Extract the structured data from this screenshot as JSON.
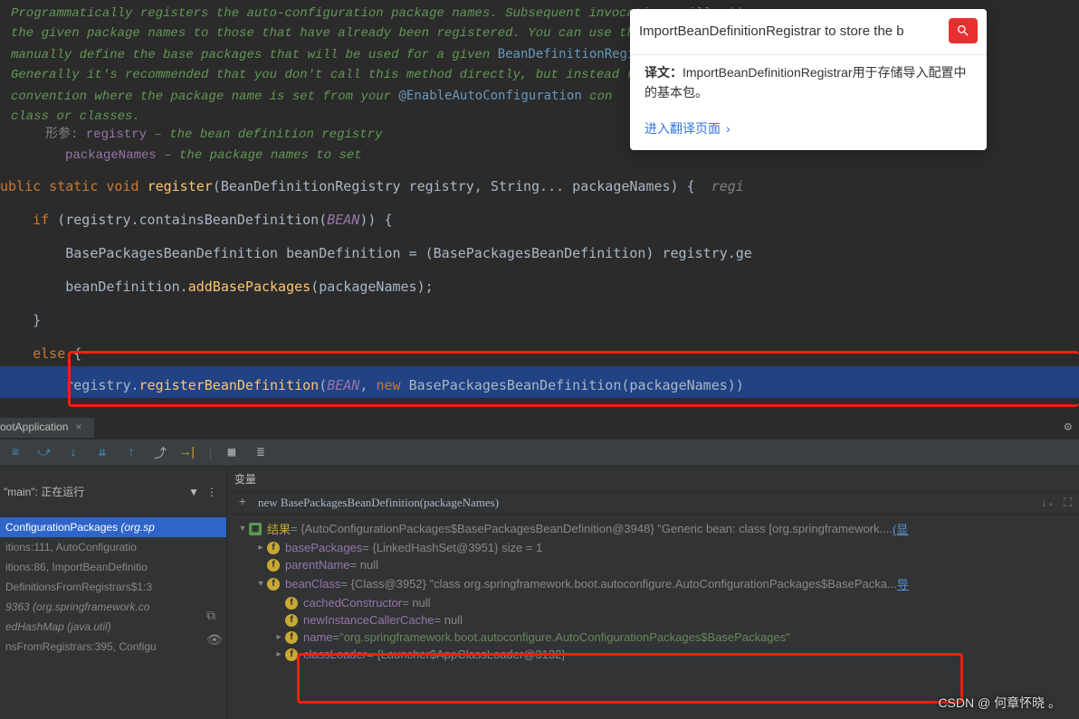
{
  "javadoc": {
    "line1a": "Programmatically registers the auto-configuration package names. Subsequent invocations will add",
    "line2a": "the given package names to those that have already been registered. You can use this method to",
    "line3a": "manually define the base packages that will be used for a given ",
    "line3b": "BeanDefinitionRegis",
    "line4a": "Generally it's recommended that you don't call this method directly, but instead rely on",
    "line5a": "convention where the package name is set from your ",
    "line5b": "@EnableAutoConfiguration",
    "line5c": " con",
    "line6a": "class or classes.",
    "params_label": "形参:",
    "param1_name": "registry",
    "param1_desc": " – the bean definition registry",
    "param2_name": "packageNames",
    "param2_desc": " – the package names to set"
  },
  "code": {
    "sig1": "ublic static void ",
    "sig2": "register",
    "sig3": "(BeanDefinitionRegistry registry, String... packageNames) {  ",
    "sig4": "regi",
    "if1": "    if ",
    "if2": "(registry.containsBeanDefinition(",
    "if3": "BEAN",
    "if4": ")) {",
    "b1": "        BasePackagesBeanDefinition beanDefinition = (BasePackagesBeanDefinition) registry.ge",
    "b2a": "        beanDefinition.",
    "b2b": "addBasePackages",
    "b2c": "(packageNames);",
    "b3": "    }",
    "else": "    else ",
    "else2": "{",
    "reg1": "        registry.",
    "reg2": "registerBeanDefinition",
    "reg3": "(",
    "reg4": "BEAN",
    "reg5": ", ",
    "reg6": "new ",
    "reg7": "BasePackagesBeanDefinition(packageNames))"
  },
  "translate": {
    "input_value": "ImportBeanDefinitionRegistrar to store the b",
    "label": "译文：",
    "text": "ImportBeanDefinitionRegistrar用于存储导入配置中的基本包。",
    "link": "进入翻译页面"
  },
  "run_tab": "ootApplication",
  "frames": {
    "header": "\"main\": 正在运行",
    "items": [
      "ConfigurationPackages",
      "(org.sp",
      "itions:111, AutoConfiguratio",
      "itions:86, ImportBeanDefinitio",
      "DefinitionsFromRegistrars$1:3",
      "9363 (org.springframework.co",
      "edHashMap (java.util)",
      "nsFromRegistrars:395, Configu"
    ]
  },
  "vars": {
    "tab": "变量",
    "expr": "new BasePackagesBeanDefinition(packageNames)",
    "result_label": "结果",
    "result_val": " = {AutoConfigurationPackages$BasePackagesBeanDefinition@3948} \"Generic bean: class [org.springframework....",
    "result_link": "(显",
    "basePackages_name": "basePackages",
    "basePackages_val": " = {LinkedHashSet@3951}  size = 1",
    "parentName_name": "parentName",
    "parentName_val": " = null",
    "beanClass_name": "beanClass",
    "beanClass_val": " = {Class@3952} \"class org.springframework.boot.autoconfigure.AutoConfigurationPackages$BasePacka...",
    "beanClass_link": " 导",
    "cachedConstructor_name": "cachedConstructor",
    "cachedConstructor_val": " = null",
    "newInstanceCallerCache_name": "newInstanceCallerCache",
    "newInstanceCallerCache_val": " = null",
    "name_name": "name",
    "name_val": " = ",
    "name_str": "\"org.springframework.boot.autoconfigure.AutoConfigurationPackages$BasePackages\"",
    "classLoader_name": "classLoader",
    "classLoader_val": " = {Launcher$AppClassLoader@3132}"
  },
  "watermark": "CSDN @ 何章怀晓 。"
}
